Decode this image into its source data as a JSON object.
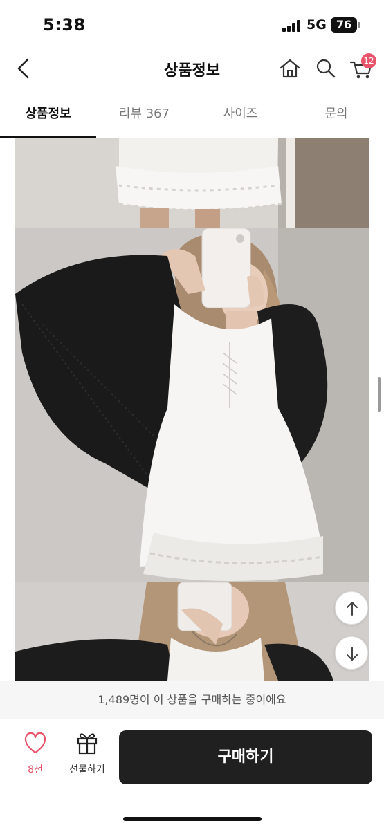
{
  "status_bar": {
    "time": "5:38",
    "network": "5G",
    "battery": "76"
  },
  "header": {
    "title": "상품정보",
    "cart_count": "12"
  },
  "tabs": [
    {
      "label": "상품정보",
      "active": true
    },
    {
      "label": "리뷰 367",
      "active": false
    },
    {
      "label": "사이즈",
      "active": false
    },
    {
      "label": "문의",
      "active": false
    }
  ],
  "bottom": {
    "buyers_text": "1,489명이 이 상품을 구매하는 중이에요",
    "like_count": "8천",
    "gift_label": "선물하기",
    "buy_label": "구매하기"
  },
  "colors": {
    "accent": "#e8546b",
    "buy_button": "#202020"
  },
  "icons": [
    "back-icon",
    "home-icon",
    "search-icon",
    "cart-icon",
    "heart-icon",
    "gift-icon",
    "arrow-up-icon",
    "arrow-down-icon"
  ]
}
